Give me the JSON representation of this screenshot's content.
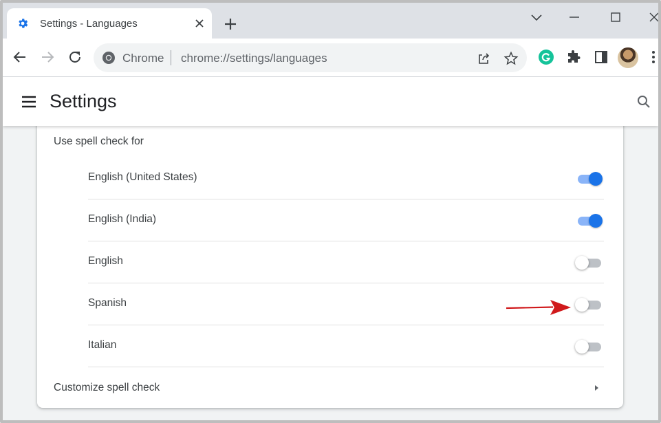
{
  "browser": {
    "tab": {
      "title": "Settings - Languages",
      "icon": "gear-icon"
    },
    "omnibox": {
      "scheme_label": "Chrome",
      "url": "chrome://settings/languages"
    },
    "colors": {
      "accent": "#1a73e8",
      "grammarly": "#15c39a",
      "annotation_arrow": "#d0191b"
    }
  },
  "settings": {
    "title": "Settings",
    "spellcheck": {
      "heading": "Use spell check for",
      "languages": [
        {
          "label": "English (United States)",
          "enabled": true
        },
        {
          "label": "English (India)",
          "enabled": true
        },
        {
          "label": "English",
          "enabled": false
        },
        {
          "label": "Spanish",
          "enabled": false
        },
        {
          "label": "Italian",
          "enabled": false
        }
      ],
      "customize_label": "Customize spell check"
    }
  }
}
